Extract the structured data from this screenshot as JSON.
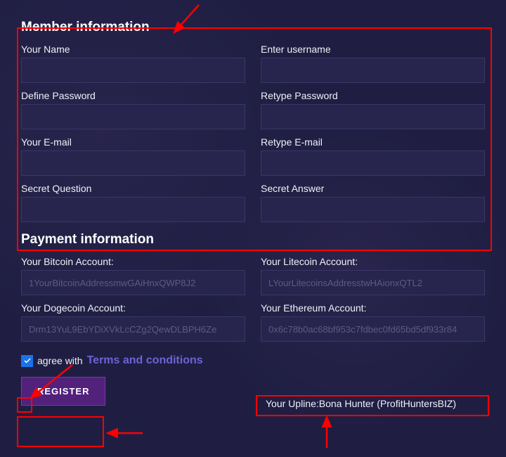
{
  "sections": {
    "member_info_title": "Member information",
    "payment_info_title": "Payment information"
  },
  "fields": {
    "your_name_label": "Your Name",
    "username_label": "Enter username",
    "define_password_label": "Define Password",
    "retype_password_label": "Retype Password",
    "your_email_label": "Your E-mail",
    "retype_email_label": "Retype E-mail",
    "secret_question_label": "Secret Question",
    "secret_answer_label": "Secret Answer",
    "bitcoin_label": "Your Bitcoin Account:",
    "litecoin_label": "Your Litecoin Account:",
    "dogecoin_label": "Your Dogecoin Account:",
    "ethereum_label": "Your Ethereum Account:",
    "bitcoin_placeholder": "1YourBitcoinAddressmwGAiHnxQWP8J2",
    "litecoin_placeholder": "LYourLitecoinsAddresstwHAionxQTL2",
    "dogecoin_placeholder": "Drm13YuL9EbYDiXVkLcCZg2QewDLBPH6Ze",
    "ethereum_placeholder": "0x6c78b0ac68bf953c7fdbec0fd65bd5df933r84"
  },
  "agreement": {
    "agree_text": " agree with ",
    "terms_text": "Terms and conditions"
  },
  "register": {
    "label": "REGISTER"
  },
  "upline": {
    "text": "Your Upline:Bona Hunter (ProfitHuntersBIZ)"
  }
}
